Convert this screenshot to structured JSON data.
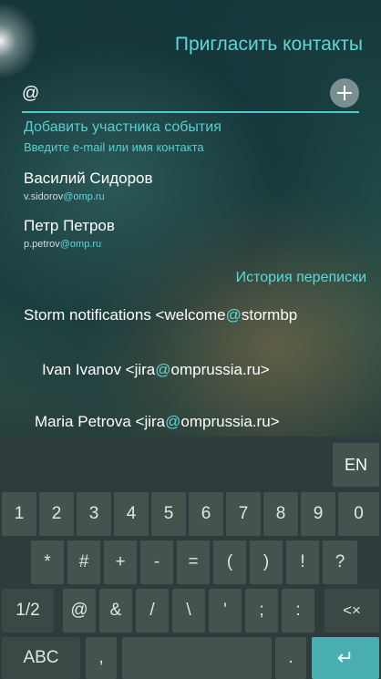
{
  "header": {
    "title": "Пригласить контакты"
  },
  "search": {
    "value": "@"
  },
  "hint": {
    "title": "Добавить участника события",
    "subtitle": "Введите e-mail или имя контакта"
  },
  "contacts": [
    {
      "name": "Василий Сидоров",
      "email_user": "v.sidorov",
      "email_domain": "@omp.ru"
    },
    {
      "name": "Петр Петров",
      "email_user": "p.petrov",
      "email_domain": "@omp.ru"
    }
  ],
  "history": {
    "label": "История переписки",
    "items": [
      {
        "before": "Storm notifications <welcome",
        "highlight": "@",
        "after": "stormbp"
      },
      {
        "before": "Ivan Ivanov <jira",
        "highlight": "@",
        "after": "omprussia.ru>"
      },
      {
        "before": "Maria Petrova <jira",
        "highlight": "@",
        "after": "omprussia.ru>"
      }
    ]
  },
  "keyboard": {
    "lang": "EN",
    "row1": [
      "1",
      "2",
      "3",
      "4",
      "5",
      "6",
      "7",
      "8",
      "9",
      "0"
    ],
    "row2": [
      "*",
      "#",
      "+",
      "-",
      "=",
      "(",
      ")",
      "!",
      "?"
    ],
    "row3": [
      "1/2",
      "@",
      "&",
      "/",
      "\\",
      "'",
      ";",
      ":",
      "<×"
    ],
    "row4": [
      "ABC",
      ",",
      "",
      ".",
      "↵"
    ]
  },
  "colors": {
    "accent": "#5fd7d8",
    "enter": "#48aeb0"
  }
}
